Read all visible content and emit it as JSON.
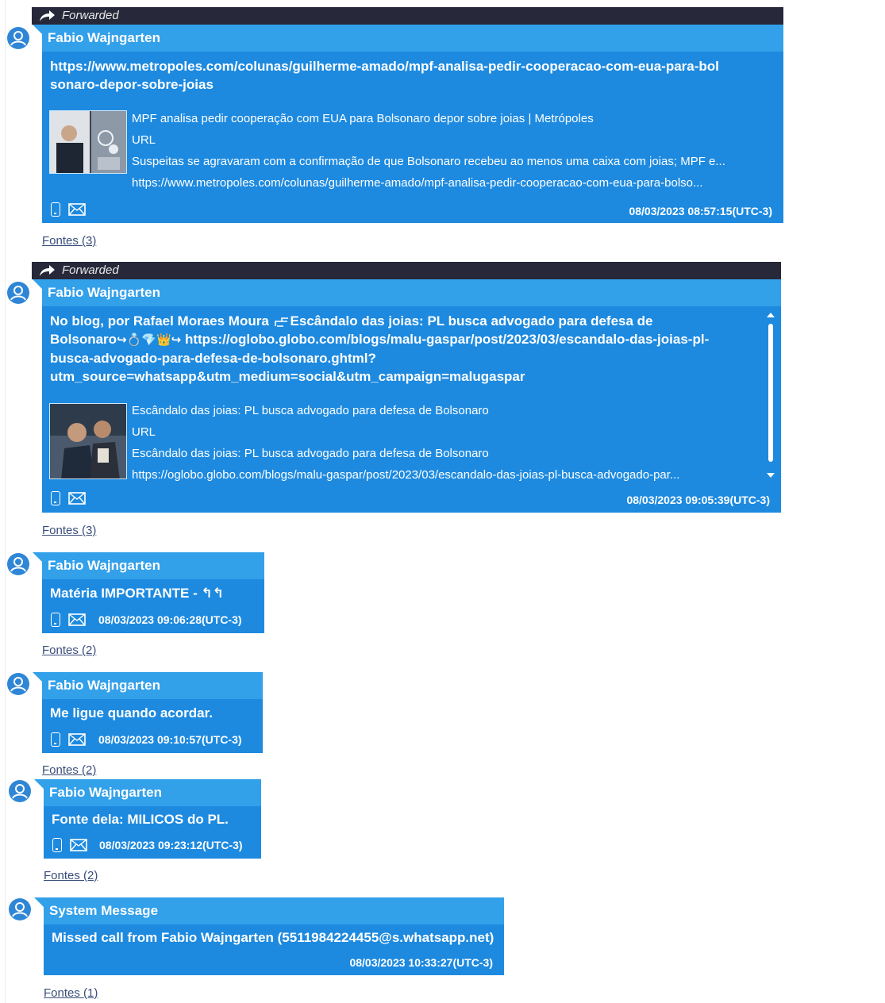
{
  "forwarded_label": "Forwarded",
  "fontes": {
    "three": "Fontes (3)",
    "two": "Fontes (2)",
    "one": "Fontes (1)"
  },
  "messages": [
    {
      "sender": "Fabio  Wajngarten",
      "link": "https://www.metropoles.com/colunas/guilherme-amado/mpf-analisa-pedir-cooperacao-com-eua-para-bolsonaro-depor-sobre-joias",
      "preview": {
        "title": "MPF analisa pedir cooperação com EUA para Bolsonaro depor sobre joias | Metrópoles",
        "type": "URL",
        "description": "Suspeitas se agravaram com a confirmação de que Bolsonaro recebeu ao menos uma caixa com joias; MPF e...",
        "url": "https://www.metropoles.com/colunas/guilherme-amado/mpf-analisa-pedir-cooperacao-com-eua-para-bolso..."
      },
      "timestamp": "08/03/2023 08:57:15(UTC-3)"
    },
    {
      "sender": "Fabio  Wajngarten",
      "text_line1_a": "No blog, por Rafael Moraes Moura",
      "text_line1_b": "Escândalo das joias: PL busca advogado para defesa de",
      "text_line2_a": "Bolsonaro",
      "text_line2_emojis": "↪💍💎👑↪",
      "text_line2_b": "https://oglobo.globo.com/blogs/malu-gaspar/post/2023/03/escandalo-das-joias-pl-",
      "text_line3": "busca-advogado-para-defesa-de-bolsonaro.ghtml?",
      "text_line4": "utm_source=whatsapp&utm_medium=social&utm_campaign=malugaspar",
      "preview": {
        "title": "Escândalo das joias: PL busca advogado para defesa de Bolsonaro",
        "type": "URL",
        "description": "Escândalo das joias: PL busca advogado para defesa de Bolsonaro",
        "url": "https://oglobo.globo.com/blogs/malu-gaspar/post/2023/03/escandalo-das-joias-pl-busca-advogado-par..."
      },
      "timestamp": "08/03/2023 09:05:39(UTC-3)"
    },
    {
      "sender": "Fabio  Wajngarten",
      "text": "Matéria IMPORTANTE - ",
      "emojis": "↰↰",
      "timestamp": "08/03/2023 09:06:28(UTC-3)"
    },
    {
      "sender": "Fabio  Wajngarten",
      "text": "Me ligue quando acordar.",
      "timestamp": "08/03/2023 09:10:57(UTC-3)"
    },
    {
      "sender": "Fabio  Wajngarten",
      "text": "Fonte dela: MILICOS do PL.",
      "timestamp": "08/03/2023 09:23:12(UTC-3)"
    },
    {
      "sender": "System Message",
      "text": "Missed call from Fabio  Wajngarten (5511984224455@s.whatsapp.net)",
      "timestamp": "08/03/2023 10:33:27(UTC-3)"
    }
  ]
}
